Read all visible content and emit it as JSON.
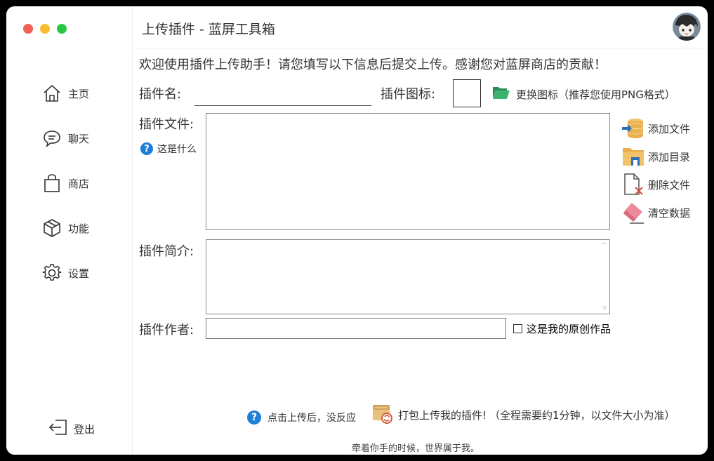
{
  "window": {
    "title": "上传插件 - 蓝屏工具箱"
  },
  "sidebar": {
    "items": [
      {
        "label": "主页",
        "icon": "home-icon"
      },
      {
        "label": "聊天",
        "icon": "chat-icon"
      },
      {
        "label": "商店",
        "icon": "shopping-bag-icon"
      },
      {
        "label": "功能",
        "icon": "cube-icon"
      },
      {
        "label": "设置",
        "icon": "gear-icon"
      }
    ],
    "logout_label": "登出"
  },
  "form": {
    "welcome": "欢迎使用插件上传助手！请您填写以下信息后提交上传。感谢您对蓝屏商店的贡献！",
    "name_label": "插件名:",
    "name_value": "",
    "icon_label": "插件图标:",
    "change_icon_label": "更换图标（推荐您使用PNG格式）",
    "files_label": "插件文件:",
    "whatis_label": "这是什么",
    "intro_label": "插件简介:",
    "intro_value": "",
    "author_label": "插件作者:",
    "author_value": "",
    "original_label": "这是我的原创作品",
    "original_checked": false
  },
  "file_actions": {
    "add_file": "添加文件",
    "add_dir": "添加目录",
    "delete_file": "删除文件",
    "clear_data": "清空数据"
  },
  "bottom": {
    "help_label": "点击上传后，没反应",
    "upload_label": "打包上传我的插件!",
    "upload_note": "（全程需要约1分钟，以文件大小为准）",
    "footer": "牵着你手的时候，世界属于我。"
  },
  "colors": {
    "accent_blue": "#1e7fd8",
    "close": "#f25f57",
    "minimize": "#f9bd2e",
    "zoom": "#2ac840"
  }
}
